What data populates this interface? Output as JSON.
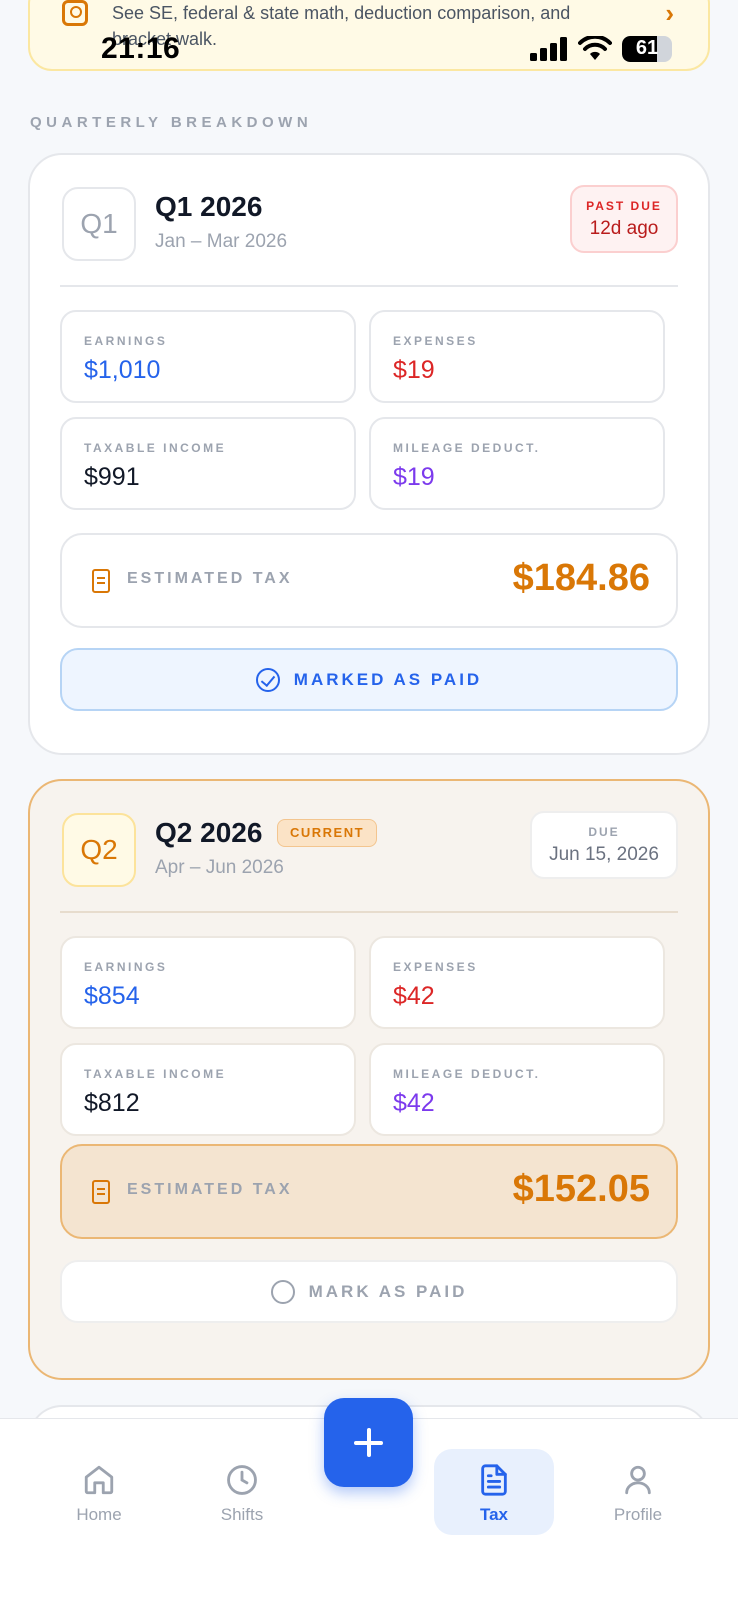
{
  "banner": {
    "text": "See SE, federal & state math, deduction comparison, and bracket walk.",
    "chevron": "›"
  },
  "status_bar": {
    "time": "21:16",
    "battery": "61"
  },
  "section_title": "QUARTERLY BREAKDOWN",
  "quarters": [
    {
      "badge": "Q1",
      "title": "Q1 2026",
      "range": "Jan – Mar 2026",
      "status_label": "PAST DUE",
      "status_value": "12d ago",
      "earnings_label": "EARNINGS",
      "earnings": "$1,010",
      "expenses_label": "EXPENSES",
      "expenses": "$19",
      "taxable_label": "TAXABLE INCOME",
      "taxable": "$991",
      "mileage_label": "MILEAGE DEDUCT.",
      "mileage": "$19",
      "est_label": "ESTIMATED TAX",
      "est_value": "$184.86",
      "pay_label": "MARKED AS PAID"
    },
    {
      "badge": "Q2",
      "title": "Q2 2026",
      "tag": "CURRENT",
      "range": "Apr – Jun 2026",
      "status_label": "DUE",
      "status_value": "Jun 15, 2026",
      "earnings_label": "EARNINGS",
      "earnings": "$854",
      "expenses_label": "EXPENSES",
      "expenses": "$42",
      "taxable_label": "TAXABLE INCOME",
      "taxable": "$812",
      "mileage_label": "MILEAGE DEDUCT.",
      "mileage": "$42",
      "est_label": "ESTIMATED TAX",
      "est_value": "$152.05",
      "pay_label": "MARK AS PAID"
    }
  ],
  "colors": {
    "earnings": "#2563EB",
    "expenses": "#DC2626",
    "taxable": "#111827",
    "mileage": "#7C3AED",
    "accent": "#D97706"
  },
  "nav": {
    "home": "Home",
    "shifts": "Shifts",
    "tax": "Tax",
    "profile": "Profile",
    "active": "tax"
  }
}
